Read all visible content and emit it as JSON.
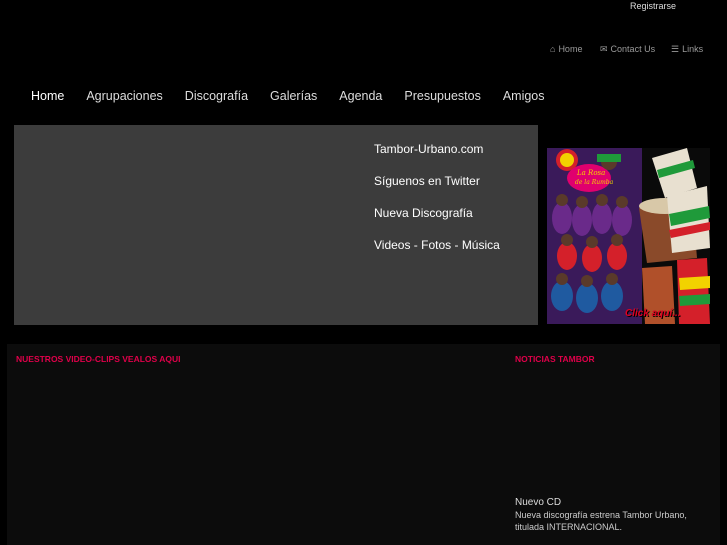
{
  "header": {
    "register_label": "Registrarse",
    "top_links": [
      {
        "label": "Home",
        "icon": "home-icon"
      },
      {
        "label": "Contact Us",
        "icon": "envelope-icon"
      },
      {
        "label": "Links",
        "icon": "list-icon"
      }
    ]
  },
  "nav": {
    "items": [
      "Home",
      "Agrupaciones",
      "Discografía",
      "Galerías",
      "Agenda",
      "Presupuestos",
      "Amigos"
    ]
  },
  "hero": {
    "links": [
      "Tambor-Urbano.com",
      "Síguenos en Twitter",
      "Nueva Discografía",
      "Videos - Fotos - Música"
    ]
  },
  "promo": {
    "caption": "Click aquí...",
    "colors": {
      "pink": "#e0006e",
      "red": "#d4202a",
      "yellow": "#f2d200",
      "green": "#1f9a3a"
    }
  },
  "lower": {
    "video_title": "NUESTROS VIDEO-CLIPS VEALOS AQUI",
    "news_title": "NOTICIAS TAMBOR",
    "news_item_title": "Nuevo CD",
    "news_item_text": "Nueva discografía estrena Tambor Urbano, titulada INTERNACIONAL."
  },
  "colors": {
    "accent": "#e0004a",
    "hero_bg": "#3c3c3c"
  }
}
